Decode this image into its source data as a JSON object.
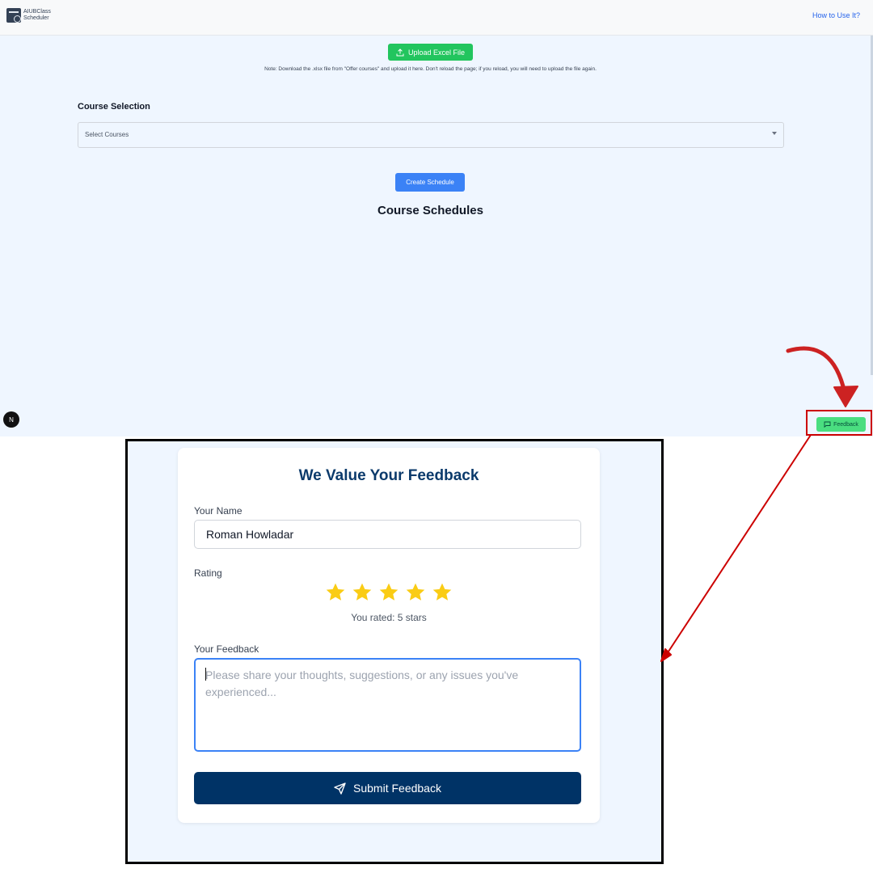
{
  "app": {
    "logo_line1": "AIUBClass",
    "logo_line2": "Scheduler",
    "how_to_link": "How to Use It?",
    "upload_button": "Upload Excel File",
    "note": "Note: Download the .xlsx file from \"Offer courses\" and upload it here. Don't reload the page; if you reload, you will need to upload the file again.",
    "course_selection_title": "Course Selection",
    "course_select_placeholder": "Select Courses",
    "create_schedule_button": "Create Schedule",
    "course_schedules_title": "Course Schedules",
    "next_badge": "N",
    "feedback_button": "Feedback"
  },
  "feedback_form": {
    "title": "We Value Your Feedback",
    "name_label": "Your Name",
    "name_value": "Roman Howladar",
    "rating_label": "Rating",
    "rating": 5,
    "rating_max": 5,
    "rated_text": "You rated: 5 stars",
    "feedback_label": "Your Feedback",
    "feedback_placeholder": "Please share your thoughts, suggestions, or any issues you've experienced...",
    "submit_button": "Submit Feedback"
  },
  "colors": {
    "upload_green": "#22c55e",
    "primary_blue": "#3b82f6",
    "title_navy": "#0b3a6b",
    "submit_navy": "#003366",
    "star_gold": "#facc15",
    "annotation_red": "#cc0000",
    "feedback_green": "#4ade80"
  },
  "icons": [
    "upload-icon",
    "chat-bubble-icon",
    "star-icon",
    "send-icon",
    "chevron-down-icon"
  ]
}
